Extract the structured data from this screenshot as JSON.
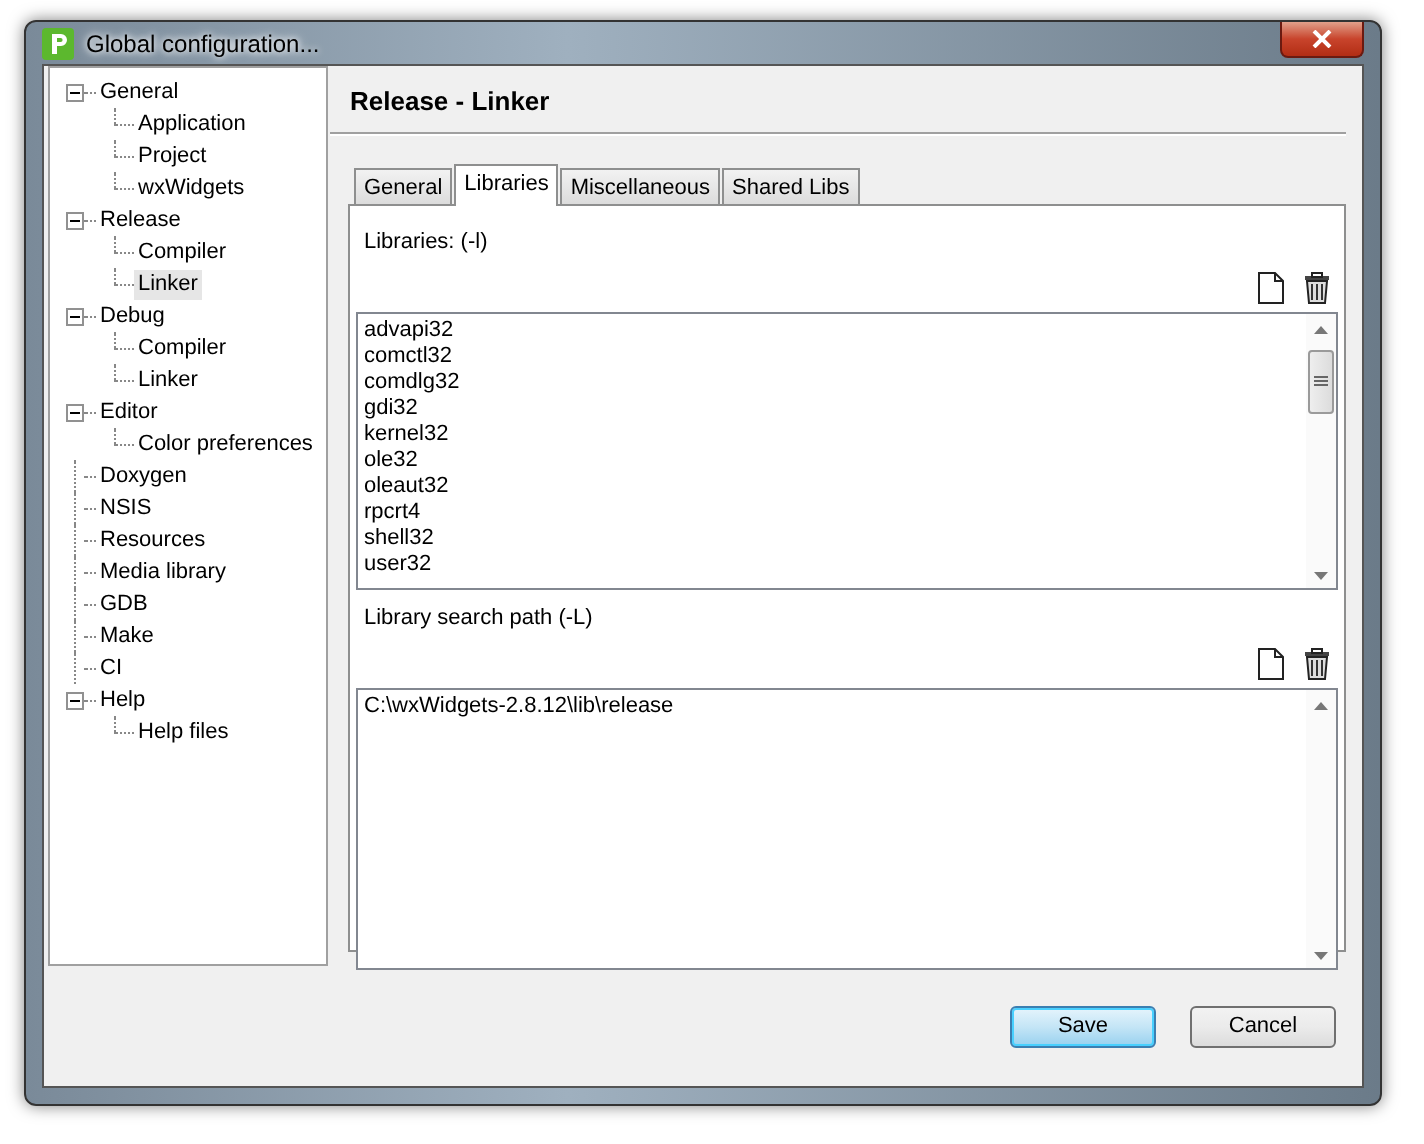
{
  "window": {
    "title": "Global configuration..."
  },
  "tree": [
    {
      "label": "General",
      "expanded": true,
      "selected": false,
      "children": [
        {
          "label": "Application",
          "selected": false
        },
        {
          "label": "Project",
          "selected": false
        },
        {
          "label": "wxWidgets",
          "selected": false
        }
      ]
    },
    {
      "label": "Release",
      "expanded": true,
      "selected": false,
      "children": [
        {
          "label": "Compiler",
          "selected": false
        },
        {
          "label": "Linker",
          "selected": true
        }
      ]
    },
    {
      "label": "Debug",
      "expanded": true,
      "selected": false,
      "children": [
        {
          "label": "Compiler",
          "selected": false
        },
        {
          "label": "Linker",
          "selected": false
        }
      ]
    },
    {
      "label": "Editor",
      "expanded": true,
      "selected": false,
      "children": [
        {
          "label": "Color preferences",
          "selected": false
        }
      ]
    },
    {
      "label": "Doxygen",
      "selected": false
    },
    {
      "label": "NSIS",
      "selected": false
    },
    {
      "label": "Resources",
      "selected": false
    },
    {
      "label": "Media library",
      "selected": false
    },
    {
      "label": "GDB",
      "selected": false
    },
    {
      "label": "Make",
      "selected": false
    },
    {
      "label": "CI",
      "selected": false
    },
    {
      "label": "Help",
      "expanded": true,
      "selected": false,
      "children": [
        {
          "label": "Help files",
          "selected": false
        }
      ]
    }
  ],
  "page_title": "Release - Linker",
  "tabs": [
    {
      "label": "General",
      "selected": false
    },
    {
      "label": "Libraries",
      "selected": true
    },
    {
      "label": "Miscellaneous",
      "selected": false
    },
    {
      "label": "Shared Libs",
      "selected": false
    }
  ],
  "sections": [
    {
      "label": "Libraries: (-l)",
      "items": [
        "advapi32",
        "comctl32",
        "comdlg32",
        "gdi32",
        "kernel32",
        "ole32",
        "oleaut32",
        "rpcrt4",
        "shell32",
        "user32"
      ]
    },
    {
      "label": "Library search path (-L)",
      "items": [
        "C:\\wxWidgets-2.8.12\\lib\\release"
      ]
    }
  ],
  "buttons": [
    {
      "label": "Save",
      "kind": "default"
    },
    {
      "label": "Cancel",
      "kind": "normal"
    }
  ]
}
